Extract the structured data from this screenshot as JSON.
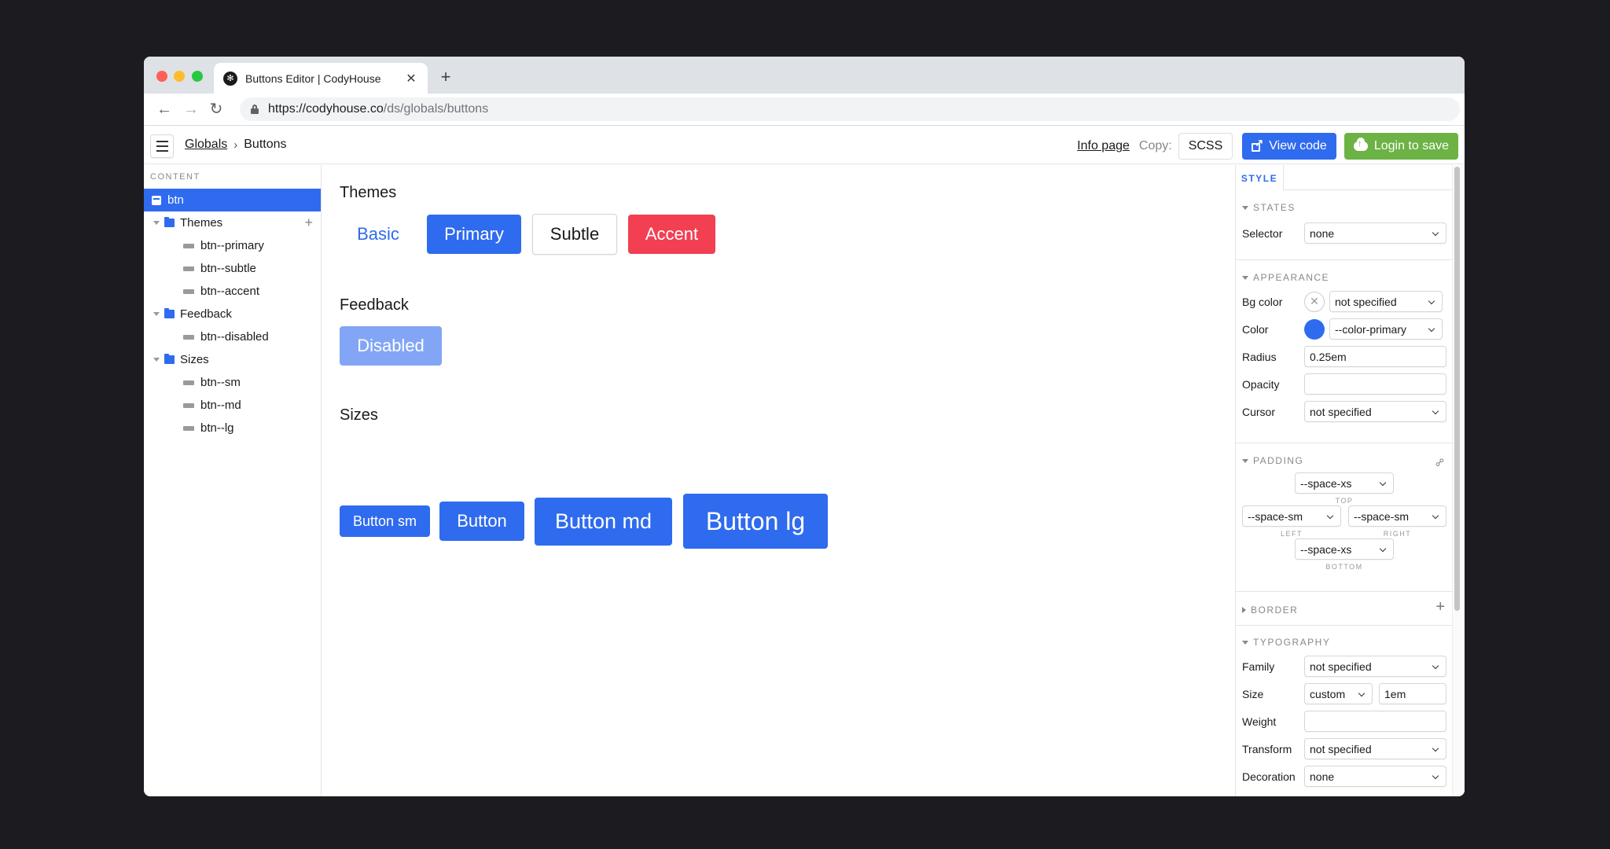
{
  "browser": {
    "tab_title": "Buttons Editor | CodyHouse",
    "url_host": "https://codyhouse.co",
    "url_path": "/ds/globals/buttons",
    "icons": {
      "back": "←",
      "forward": "→",
      "reload": "↻",
      "close": "✕",
      "new_tab": "+",
      "favicon": "✻"
    }
  },
  "header": {
    "breadcrumb": {
      "parent": "Globals",
      "separator": "›",
      "current": "Buttons"
    },
    "info_link": "Info page",
    "copy_label": "Copy:",
    "scss_label": "SCSS",
    "view_code_label": "View code",
    "login_label": "Login to save",
    "colors": {
      "primary": "#2f6bee",
      "success": "#6cb245",
      "accent": "#f23f52"
    }
  },
  "sidebar": {
    "heading": "CONTENT",
    "root": "btn",
    "groups": [
      {
        "label": "Themes",
        "items": [
          "btn--primary",
          "btn--subtle",
          "btn--accent"
        ]
      },
      {
        "label": "Feedback",
        "items": [
          "btn--disabled"
        ]
      },
      {
        "label": "Sizes",
        "items": [
          "btn--sm",
          "btn--md",
          "btn--lg"
        ]
      }
    ],
    "add_icon": "+"
  },
  "main": {
    "themes": {
      "title": "Themes",
      "buttons": [
        "Basic",
        "Primary",
        "Subtle",
        "Accent"
      ]
    },
    "feedback": {
      "title": "Feedback",
      "buttons": [
        "Disabled"
      ]
    },
    "sizes": {
      "title": "Sizes",
      "buttons": [
        "Button sm",
        "Button",
        "Button md",
        "Button lg"
      ]
    }
  },
  "panel": {
    "tab": "STYLE",
    "states": {
      "title": "STATES",
      "selector_label": "Selector",
      "selector_value": "none"
    },
    "appearance": {
      "title": "APPEARANCE",
      "bg_label": "Bg color",
      "bg_value": "not specified",
      "color_label": "Color",
      "color_value": "--color-primary",
      "color_swatch": "#2f6bee",
      "radius_label": "Radius",
      "radius_value": "0.25em",
      "opacity_label": "Opacity",
      "opacity_value": "",
      "cursor_label": "Cursor",
      "cursor_value": "not specified"
    },
    "padding": {
      "title": "PADDING",
      "top": "--space-xs",
      "top_label": "TOP",
      "left": "--space-sm",
      "left_label": "LEFT",
      "right": "--space-sm",
      "right_label": "RIGHT",
      "bottom": "--space-xs",
      "bottom_label": "BOTTOM"
    },
    "border": {
      "title": "BORDER"
    },
    "typography": {
      "title": "TYPOGRAPHY",
      "family_label": "Family",
      "family_value": "not specified",
      "size_label": "Size",
      "size_unit": "custom",
      "size_value": "1em",
      "weight_label": "Weight",
      "weight_value": "",
      "transform_label": "Transform",
      "transform_value": "not specified",
      "decoration_label": "Decoration",
      "decoration_value": "none"
    }
  }
}
